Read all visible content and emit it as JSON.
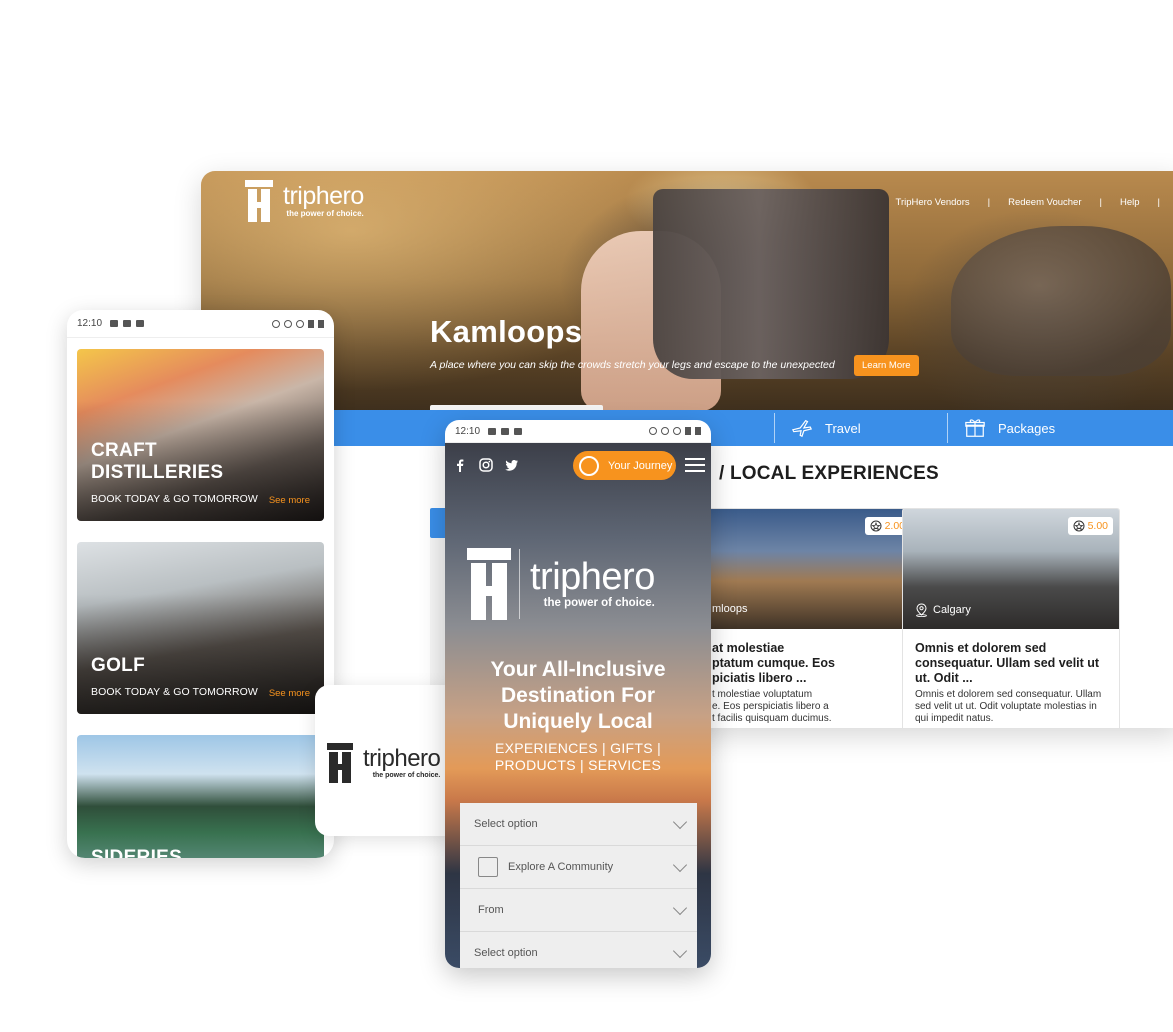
{
  "desktop": {
    "brand": {
      "name": "triphero",
      "tagline": "the power of choice."
    },
    "nav": [
      "TripHero Vendors",
      "Redeem Voucher",
      "Help"
    ],
    "hero": {
      "title": "Kamloops",
      "subtitle": "A place where you can skip the crowds stretch your legs and escape to the unexpected",
      "button": "Learn More"
    },
    "tabs": [
      {
        "label": "Travel",
        "icon": "plane-icon"
      },
      {
        "label": "Packages",
        "icon": "gift-icon"
      }
    ],
    "section_title": "LOCAL EXPERIENCES",
    "cards": [
      {
        "rating": "2.00",
        "location": "mloops",
        "title": "at molestiae\nptatum cumque. Eos\npiciatis libero ...",
        "description": "t molestiae voluptatum\ne. Eos perspiciatis libero a\nt facilis quisquam ducimus."
      },
      {
        "rating": "5.00",
        "location": "Calgary",
        "title": "Omnis et dolorem sed consequatur. Ullam sed velit ut ut. Odit ...",
        "description": "Omnis et dolorem sed consequatur. Ullam sed velit ut ut. Odit voluptate molestias in qui impedit natus."
      }
    ]
  },
  "phone_left": {
    "time": "12:10",
    "cards": [
      {
        "title": "CRAFT\nDISTILLERIES",
        "cta": "BOOK TODAY & GO TOMORROW",
        "more": "See more"
      },
      {
        "title": "GOLF",
        "cta": "BOOK TODAY & GO TOMORROW",
        "more": "See more"
      },
      {
        "title": "SIDERIES",
        "cta": "",
        "more": ""
      }
    ]
  },
  "logo_card": {
    "name": "triphero",
    "tagline": "the power of choice."
  },
  "phone_center": {
    "time": "12:10",
    "journey_button": "Your Journey",
    "brand": {
      "name": "triphero",
      "tagline": "the power of choice."
    },
    "headline": "Your All-Inclusive Destination For Uniquely Local",
    "subline": "EXPERIENCES | GIFTS | PRODUCTS | SERVICES",
    "selects": [
      "Select option",
      "Explore A Community",
      "From",
      "Select option"
    ]
  },
  "colors": {
    "accent": "#f7931e",
    "primary_blue": "#3a8ee8",
    "text_dark": "#1e1e1e"
  }
}
